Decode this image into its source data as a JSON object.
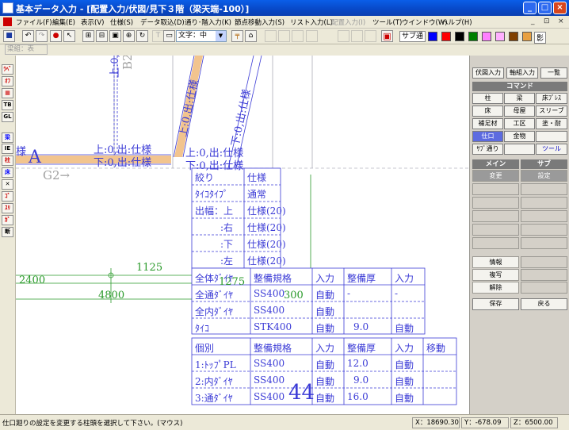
{
  "window": {
    "title": "基本データ入力 - [配置入力/伏図/見下３階（梁天端-100）]",
    "minimize": "_",
    "maximize": "□",
    "close": "×"
  },
  "menu": [
    {
      "label": "ファイル(F)",
      "enabled": true
    },
    {
      "label": "編集(E)",
      "enabled": true
    },
    {
      "label": "表示(V)",
      "enabled": true
    },
    {
      "label": "仕様(S)",
      "enabled": true
    },
    {
      "label": "データ取込(D)",
      "enabled": true
    },
    {
      "label": "通り･階入力(K)",
      "enabled": true
    },
    {
      "label": "節点移動入力(S)",
      "enabled": true
    },
    {
      "label": "リスト入力(L)",
      "enabled": true
    },
    {
      "label": "配置入力(I)",
      "enabled": false
    },
    {
      "label": "ツール(T)",
      "enabled": true
    },
    {
      "label": "ウインドウ(W)",
      "enabled": true
    },
    {
      "label": "ヘルプ(H)",
      "enabled": true
    }
  ],
  "mdi": {
    "minimize": "_",
    "restore": "⊡",
    "close": "×"
  },
  "toolbar": {
    "font_select": "文字：中",
    "sub_label": "サブ通",
    "shadow_label": "影",
    "colors": [
      "#0000ff",
      "#ff0000",
      "#000000",
      "#008000",
      "#ff80ff",
      "#ffb0ff",
      "#804000",
      "#e8a040"
    ]
  },
  "row2": {
    "layer_select": "梁組：表"
  },
  "left_tools": [
    "ﾗﾍﾞﾙ",
    "ｵﾌ",
    "▦",
    "TB",
    "GL",
    "梁",
    "IE",
    "柱",
    "床",
    "✕",
    "ｺﾞ",
    "ｽﾘ",
    "ｶﾞ",
    "断"
  ],
  "canvas": {
    "axis_labels": [
      "A",
      "G2→",
      "B2→"
    ],
    "callout_rows": [
      [
        "絞り",
        "仕様"
      ],
      [
        "ﾀｲｺﾀｲﾌﾟ",
        "通常"
      ],
      [
        "出幅：上",
        "仕様(20)"
      ],
      [
        ":右",
        "仕様(20)"
      ],
      [
        ":下",
        "仕様(20)"
      ],
      [
        ":左",
        "仕様(20)"
      ]
    ],
    "table1_header": [
      "全体ﾀﾞｲﾔ",
      "整備規格",
      "入力",
      "整備厚",
      "入力"
    ],
    "table1_rows": [
      [
        "全通ﾀﾞｲﾔ",
        "SS400",
        "自動",
        "-",
        "-"
      ],
      [
        "全内ﾀﾞｲﾔ",
        "SS400",
        "自動",
        "",
        ""
      ],
      [
        "ﾀｲｺ",
        "STK400",
        "自動",
        "9.0",
        "自動"
      ]
    ],
    "table2_header": [
      "個別",
      "整備規格",
      "入力",
      "整備厚",
      "入力",
      "移動"
    ],
    "table2_rows": [
      [
        "1:ﾄｯﾌﾟPL",
        "SS400",
        "自動",
        "12.0",
        "自動",
        ""
      ],
      [
        "2:内ﾀﾞｲﾔ",
        "SS400",
        "自動",
        "9.0",
        "自動",
        ""
      ],
      [
        "3:通ﾀﾞｲﾔ",
        "SS400",
        "自動",
        "16.0",
        "自動",
        ""
      ]
    ],
    "beam_labels": [
      "上:0,出:仕様",
      "下:0,出:仕様",
      "梁",
      "様"
    ],
    "dim_labels": [
      "1125",
      "2400",
      "1275",
      "4800",
      "300",
      "44"
    ]
  },
  "right_panel": {
    "tabs": [
      "伏図入力",
      "軸組入力",
      "一覧"
    ],
    "command_header": "コマンド",
    "commands": [
      [
        "柱",
        "梁",
        "床ﾌﾞﾚｽ"
      ],
      [
        "床",
        "母屋",
        "スリーブ"
      ],
      [
        "補足材",
        "工区",
        "塗・耐"
      ],
      [
        "仕口",
        "金物",
        ""
      ],
      [
        "ｻﾌﾞ通り",
        "",
        "ツール"
      ]
    ],
    "main_header": "メイン",
    "sub_header": "サブ",
    "main_first": "変更",
    "sub_first": "設定",
    "main_items": [
      "情報",
      "複写",
      "解除"
    ],
    "save": "保存",
    "back": "戻る"
  },
  "status": {
    "message": "仕口廻りの設定を変更する柱頭を選択して下さい。(マウス)",
    "x": "X：18690.30",
    "y": "Y：-678.09",
    "z": "Z：6500.00"
  }
}
